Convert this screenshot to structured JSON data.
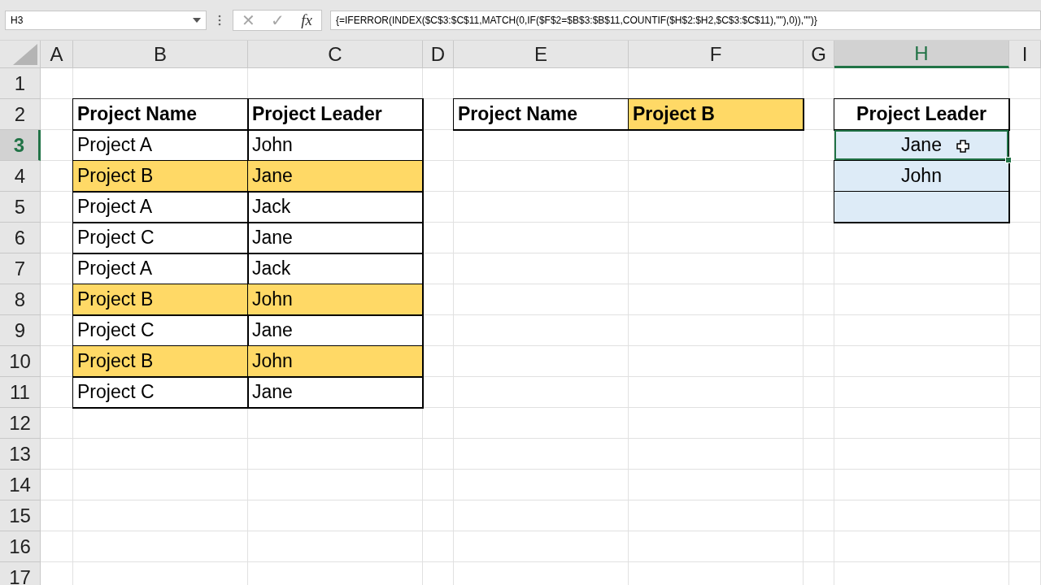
{
  "formula_bar": {
    "name_box": "H3",
    "cancel_label": "✕",
    "enter_label": "✓",
    "function_label": "fx",
    "formula": "{=IFERROR(INDEX($C$3:$C$11,MATCH(0,IF($F$2=$B$3:$B$11,COUNTIF($H$2:$H2,$C$3:$C$11),\"\"),0)),\"\")}"
  },
  "columns": [
    {
      "label": "A",
      "selected": false
    },
    {
      "label": "B",
      "selected": false
    },
    {
      "label": "C",
      "selected": false
    },
    {
      "label": "D",
      "selected": false
    },
    {
      "label": "E",
      "selected": false
    },
    {
      "label": "F",
      "selected": false
    },
    {
      "label": "G",
      "selected": false
    },
    {
      "label": "H",
      "selected": true
    },
    {
      "label": "I",
      "selected": false
    }
  ],
  "rows": [
    {
      "label": "1",
      "selected": false,
      "cells": [
        {
          "kind": "blank",
          "selected": false
        },
        {
          "kind": "blank",
          "selected": false
        },
        {
          "kind": "blank",
          "selected": false
        },
        {
          "kind": "blank",
          "selected": false
        },
        {
          "kind": "blank",
          "selected": false
        },
        {
          "kind": "blank",
          "selected": false
        },
        {
          "kind": "blank",
          "selected": false
        },
        {
          "kind": "blank",
          "selected": false
        },
        {
          "kind": "blank",
          "selected": false
        }
      ]
    },
    {
      "label": "2",
      "selected": false,
      "cells": [
        {
          "kind": "blank",
          "selected": false
        },
        {
          "kind": "header",
          "text": "Project Name",
          "selected": false
        },
        {
          "kind": "header",
          "text": "Project Leader",
          "selected": false
        },
        {
          "kind": "blank",
          "selected": false
        },
        {
          "kind": "header",
          "text": "Project Name",
          "selected": false
        },
        {
          "kind": "highlight-header",
          "text": "Project B",
          "selected": false
        },
        {
          "kind": "blank",
          "selected": false
        },
        {
          "kind": "result-header",
          "text": "Project Leader",
          "selected": false
        },
        {
          "kind": "blank",
          "selected": false
        }
      ]
    },
    {
      "label": "3",
      "selected": true,
      "cells": [
        {
          "kind": "blank",
          "selected": false
        },
        {
          "kind": "data",
          "text": "Project A",
          "selected": false
        },
        {
          "kind": "data",
          "text": "John",
          "selected": false
        },
        {
          "kind": "blank",
          "selected": false
        },
        {
          "kind": "blank",
          "selected": false
        },
        {
          "kind": "blank",
          "selected": false
        },
        {
          "kind": "blank",
          "selected": false
        },
        {
          "kind": "result",
          "text": "Jane",
          "selected": true
        },
        {
          "kind": "blank",
          "selected": false
        }
      ]
    },
    {
      "label": "4",
      "selected": false,
      "cells": [
        {
          "kind": "blank",
          "selected": false
        },
        {
          "kind": "highlight",
          "text": "Project B",
          "selected": false
        },
        {
          "kind": "highlight",
          "text": "Jane",
          "selected": false
        },
        {
          "kind": "blank",
          "selected": false
        },
        {
          "kind": "blank",
          "selected": false
        },
        {
          "kind": "blank",
          "selected": false
        },
        {
          "kind": "blank",
          "selected": false
        },
        {
          "kind": "result",
          "text": "John",
          "selected": false
        },
        {
          "kind": "blank",
          "selected": false
        }
      ]
    },
    {
      "label": "5",
      "selected": false,
      "cells": [
        {
          "kind": "blank",
          "selected": false
        },
        {
          "kind": "data",
          "text": "Project A",
          "selected": false
        },
        {
          "kind": "data",
          "text": "Jack",
          "selected": false
        },
        {
          "kind": "blank",
          "selected": false
        },
        {
          "kind": "blank",
          "selected": false
        },
        {
          "kind": "blank",
          "selected": false
        },
        {
          "kind": "blank",
          "selected": false
        },
        {
          "kind": "result",
          "selected": false
        },
        {
          "kind": "blank",
          "selected": false
        }
      ]
    },
    {
      "label": "6",
      "selected": false,
      "cells": [
        {
          "kind": "blank",
          "selected": false
        },
        {
          "kind": "data",
          "text": "Project C",
          "selected": false
        },
        {
          "kind": "data",
          "text": "Jane",
          "selected": false
        },
        {
          "kind": "blank",
          "selected": false
        },
        {
          "kind": "blank",
          "selected": false
        },
        {
          "kind": "blank",
          "selected": false
        },
        {
          "kind": "blank",
          "selected": false
        },
        {
          "kind": "blank",
          "selected": false
        },
        {
          "kind": "blank",
          "selected": false
        }
      ]
    },
    {
      "label": "7",
      "selected": false,
      "cells": [
        {
          "kind": "blank",
          "selected": false
        },
        {
          "kind": "data",
          "text": "Project A",
          "selected": false
        },
        {
          "kind": "data",
          "text": "Jack",
          "selected": false
        },
        {
          "kind": "blank",
          "selected": false
        },
        {
          "kind": "blank",
          "selected": false
        },
        {
          "kind": "blank",
          "selected": false
        },
        {
          "kind": "blank",
          "selected": false
        },
        {
          "kind": "blank",
          "selected": false
        },
        {
          "kind": "blank",
          "selected": false
        }
      ]
    },
    {
      "label": "8",
      "selected": false,
      "cells": [
        {
          "kind": "blank",
          "selected": false
        },
        {
          "kind": "highlight",
          "text": "Project B",
          "selected": false
        },
        {
          "kind": "highlight",
          "text": "John",
          "selected": false
        },
        {
          "kind": "blank",
          "selected": false
        },
        {
          "kind": "blank",
          "selected": false
        },
        {
          "kind": "blank",
          "selected": false
        },
        {
          "kind": "blank",
          "selected": false
        },
        {
          "kind": "blank",
          "selected": false
        },
        {
          "kind": "blank",
          "selected": false
        }
      ]
    },
    {
      "label": "9",
      "selected": false,
      "cells": [
        {
          "kind": "blank",
          "selected": false
        },
        {
          "kind": "data",
          "text": "Project C",
          "selected": false
        },
        {
          "kind": "data",
          "text": "Jane",
          "selected": false
        },
        {
          "kind": "blank",
          "selected": false
        },
        {
          "kind": "blank",
          "selected": false
        },
        {
          "kind": "blank",
          "selected": false
        },
        {
          "kind": "blank",
          "selected": false
        },
        {
          "kind": "blank",
          "selected": false
        },
        {
          "kind": "blank",
          "selected": false
        }
      ]
    },
    {
      "label": "10",
      "selected": false,
      "cells": [
        {
          "kind": "blank",
          "selected": false
        },
        {
          "kind": "highlight",
          "text": "Project B",
          "selected": false
        },
        {
          "kind": "highlight",
          "text": "John",
          "selected": false
        },
        {
          "kind": "blank",
          "selected": false
        },
        {
          "kind": "blank",
          "selected": false
        },
        {
          "kind": "blank",
          "selected": false
        },
        {
          "kind": "blank",
          "selected": false
        },
        {
          "kind": "blank",
          "selected": false
        },
        {
          "kind": "blank",
          "selected": false
        }
      ]
    },
    {
      "label": "11",
      "selected": false,
      "cells": [
        {
          "kind": "blank",
          "selected": false
        },
        {
          "kind": "data",
          "text": "Project C",
          "selected": false
        },
        {
          "kind": "data",
          "text": "Jane",
          "selected": false
        },
        {
          "kind": "blank",
          "selected": false
        },
        {
          "kind": "blank",
          "selected": false
        },
        {
          "kind": "blank",
          "selected": false
        },
        {
          "kind": "blank",
          "selected": false
        },
        {
          "kind": "blank",
          "selected": false
        },
        {
          "kind": "blank",
          "selected": false
        }
      ]
    },
    {
      "label": "12",
      "selected": false,
      "cells": [
        {
          "kind": "blank",
          "selected": false
        },
        {
          "kind": "blank",
          "selected": false
        },
        {
          "kind": "blank",
          "selected": false
        },
        {
          "kind": "blank",
          "selected": false
        },
        {
          "kind": "blank",
          "selected": false
        },
        {
          "kind": "blank",
          "selected": false
        },
        {
          "kind": "blank",
          "selected": false
        },
        {
          "kind": "blank",
          "selected": false
        },
        {
          "kind": "blank",
          "selected": false
        }
      ]
    },
    {
      "label": "13",
      "selected": false,
      "cells": [
        {
          "kind": "blank",
          "selected": false
        },
        {
          "kind": "blank",
          "selected": false
        },
        {
          "kind": "blank",
          "selected": false
        },
        {
          "kind": "blank",
          "selected": false
        },
        {
          "kind": "blank",
          "selected": false
        },
        {
          "kind": "blank",
          "selected": false
        },
        {
          "kind": "blank",
          "selected": false
        },
        {
          "kind": "blank",
          "selected": false
        },
        {
          "kind": "blank",
          "selected": false
        }
      ]
    },
    {
      "label": "14",
      "selected": false,
      "cells": [
        {
          "kind": "blank",
          "selected": false
        },
        {
          "kind": "blank",
          "selected": false
        },
        {
          "kind": "blank",
          "selected": false
        },
        {
          "kind": "blank",
          "selected": false
        },
        {
          "kind": "blank",
          "selected": false
        },
        {
          "kind": "blank",
          "selected": false
        },
        {
          "kind": "blank",
          "selected": false
        },
        {
          "kind": "blank",
          "selected": false
        },
        {
          "kind": "blank",
          "selected": false
        }
      ]
    },
    {
      "label": "15",
      "selected": false,
      "cells": [
        {
          "kind": "blank",
          "selected": false
        },
        {
          "kind": "blank",
          "selected": false
        },
        {
          "kind": "blank",
          "selected": false
        },
        {
          "kind": "blank",
          "selected": false
        },
        {
          "kind": "blank",
          "selected": false
        },
        {
          "kind": "blank",
          "selected": false
        },
        {
          "kind": "blank",
          "selected": false
        },
        {
          "kind": "blank",
          "selected": false
        },
        {
          "kind": "blank",
          "selected": false
        }
      ]
    },
    {
      "label": "16",
      "selected": false,
      "cells": [
        {
          "kind": "blank",
          "selected": false
        },
        {
          "kind": "blank",
          "selected": false
        },
        {
          "kind": "blank",
          "selected": false
        },
        {
          "kind": "blank",
          "selected": false
        },
        {
          "kind": "blank",
          "selected": false
        },
        {
          "kind": "blank",
          "selected": false
        },
        {
          "kind": "blank",
          "selected": false
        },
        {
          "kind": "blank",
          "selected": false
        },
        {
          "kind": "blank",
          "selected": false
        }
      ]
    },
    {
      "label": "17",
      "selected": false,
      "cells": [
        {
          "kind": "blank",
          "selected": false
        },
        {
          "kind": "blank",
          "selected": false
        },
        {
          "kind": "blank",
          "selected": false
        },
        {
          "kind": "blank",
          "selected": false
        },
        {
          "kind": "blank",
          "selected": false
        },
        {
          "kind": "blank",
          "selected": false
        },
        {
          "kind": "blank",
          "selected": false
        },
        {
          "kind": "blank",
          "selected": false
        },
        {
          "kind": "blank",
          "selected": false
        }
      ]
    }
  ]
}
